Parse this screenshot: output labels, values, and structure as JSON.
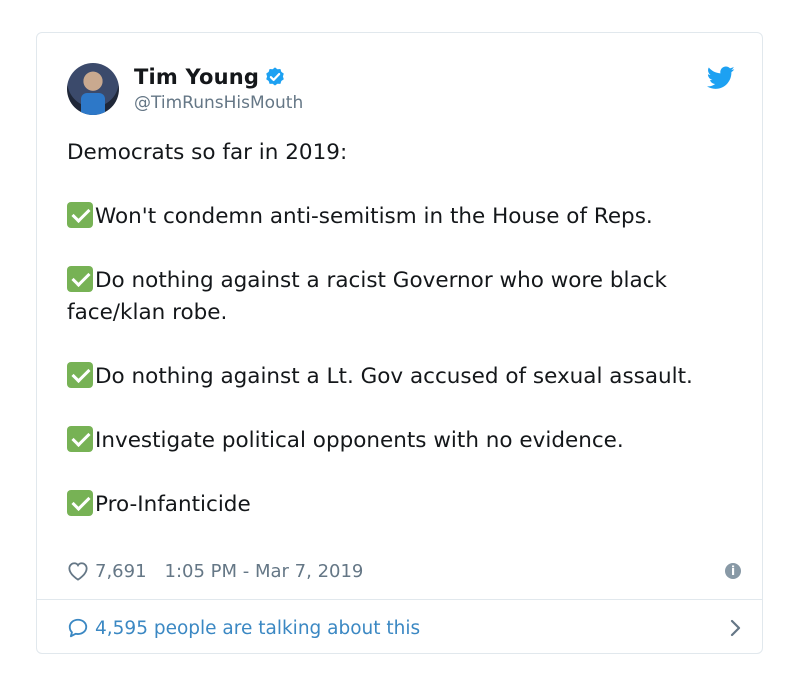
{
  "tweet": {
    "author_name": "Tim Young",
    "author_handle": "@TimRunsHisMouth",
    "paragraphs": [
      "Democrats so far in 2019:",
      "Won't condemn anti-semitism in the House of Reps.",
      "Do nothing against a racist Governor who wore black face/klan robe.",
      "Do nothing against a Lt. Gov accused of sexual assault.",
      "Investigate political opponents with no evidence.",
      "Pro-Infanticide"
    ],
    "likes": "7,691",
    "timestamp": "1:05 PM - Mar 7, 2019",
    "talking": "4,595 people are talking about this"
  },
  "icons": {
    "verified": "verified-badge-icon",
    "bird": "twitter-bird-icon",
    "check": "white-check-mark-icon",
    "heart": "heart-icon",
    "info": "info-icon",
    "bubble": "comment-bubble-icon",
    "chevron": "chevron-right-icon"
  },
  "colors": {
    "accent": "#1da1f2",
    "link": "#3b88c3",
    "check_green": "#77b255",
    "muted": "#657786",
    "border": "#e1e8ed"
  }
}
